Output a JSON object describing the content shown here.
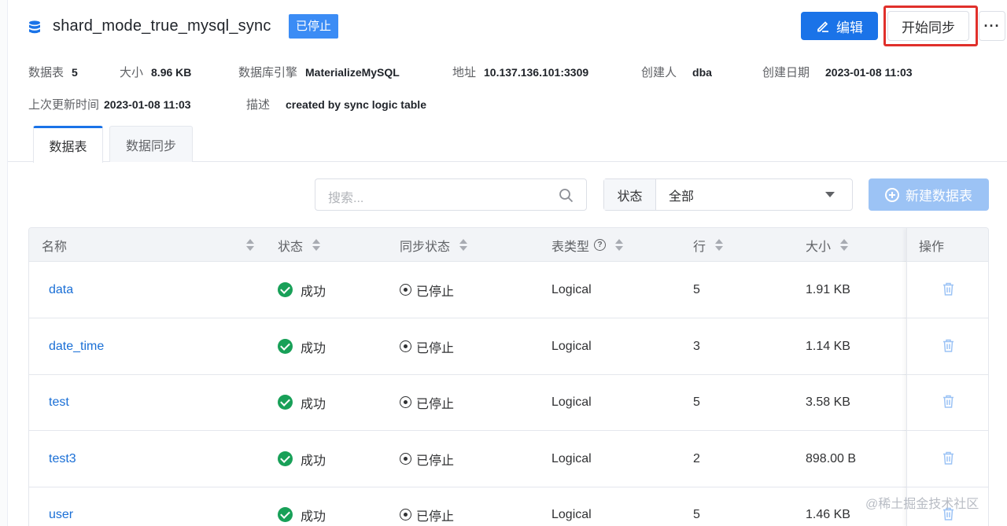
{
  "header": {
    "title": "shard_mode_true_mysql_sync",
    "status_tag": "已停止",
    "edit_label": "编辑",
    "start_sync_label": "开始同步",
    "more_label": "···"
  },
  "meta": {
    "tables_label": "数据表",
    "tables_value": "5",
    "size_label": "大小",
    "size_value": "8.96 KB",
    "engine_label": "数据库引擎",
    "engine_value": "MaterializeMySQL",
    "address_label": "地址",
    "address_value": "10.137.136.101:3309",
    "creator_label": "创建人",
    "creator_value": "dba",
    "created_label": "创建日期",
    "created_value": "2023-01-08 11:03",
    "updated_label": "上次更新时间",
    "updated_value": "2023-01-08 11:03",
    "desc_label": "描述",
    "desc_value": "created by sync logic table"
  },
  "tabs": [
    {
      "label": "数据表",
      "active": true
    },
    {
      "label": "数据同步",
      "active": false
    }
  ],
  "toolbar": {
    "search_placeholder": "搜索...",
    "status_label": "状态",
    "status_value": "全部",
    "new_table_label": "新建数据表"
  },
  "table": {
    "columns": [
      "名称",
      "状态",
      "同步状态",
      "表类型",
      "行",
      "大小",
      "操作"
    ],
    "rows": [
      {
        "name": "data",
        "status": "成功",
        "sync": "已停止",
        "type": "Logical",
        "rows": "5",
        "size": "1.91 KB"
      },
      {
        "name": "date_time",
        "status": "成功",
        "sync": "已停止",
        "type": "Logical",
        "rows": "3",
        "size": "1.14 KB"
      },
      {
        "name": "test",
        "status": "成功",
        "sync": "已停止",
        "type": "Logical",
        "rows": "5",
        "size": "3.58 KB"
      },
      {
        "name": "test3",
        "status": "成功",
        "sync": "已停止",
        "type": "Logical",
        "rows": "2",
        "size": "898.00 B"
      },
      {
        "name": "user",
        "status": "成功",
        "sync": "已停止",
        "type": "Logical",
        "rows": "5",
        "size": "1.46 KB"
      }
    ]
  },
  "watermark": "@稀土掘金技术社区",
  "colors": {
    "primary": "#1a73e8",
    "success": "#18a058",
    "highlight": "#e0302b"
  }
}
